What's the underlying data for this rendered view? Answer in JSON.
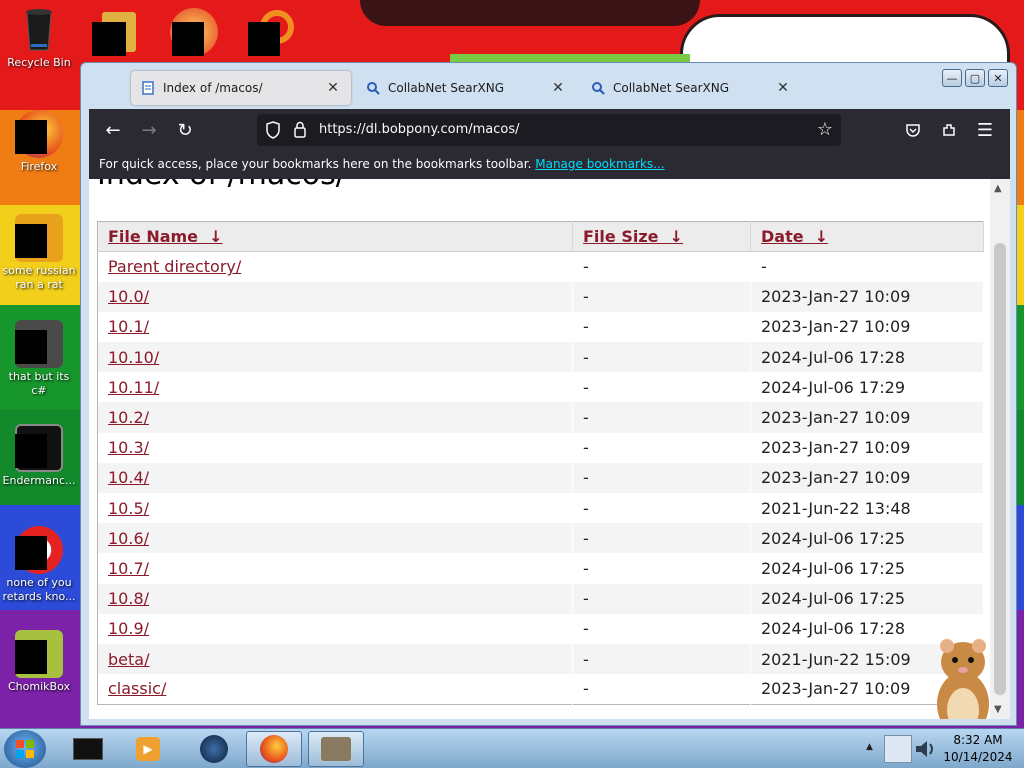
{
  "desktop": {
    "icons": [
      {
        "label": "Recycle Bin",
        "icon": "recycle-bin-icon"
      },
      {
        "label": "Firefox",
        "icon": "firefox-icon"
      },
      {
        "label": "some russian ran a rat",
        "icon": "app-icon"
      },
      {
        "label": "that but its c#",
        "icon": "windows-icon"
      },
      {
        "label": "Endermanc...",
        "icon": "terminal-icon"
      },
      {
        "label": "none of you retards kno...",
        "icon": "opera-icon"
      },
      {
        "label": "ChomikBox",
        "icon": "chomikbox-icon"
      }
    ]
  },
  "browser": {
    "tabs": [
      {
        "title": "Index of /macos/",
        "icon": "page-icon",
        "active": true
      },
      {
        "title": "CollabNet SearXNG",
        "icon": "search-icon",
        "active": false
      },
      {
        "title": "CollabNet SearXNG",
        "icon": "search-icon",
        "active": false
      }
    ],
    "window_buttons": {
      "minimize": "—",
      "maximize": "▢",
      "close": "✕"
    },
    "url": "https://dl.bobpony.com/macos/",
    "bookmarks_bar": {
      "message": "For quick access, place your bookmarks here on the bookmarks toolbar.",
      "link": "Manage bookmarks..."
    }
  },
  "page": {
    "heading": "Index of /macos/",
    "columns": [
      {
        "label": "File Name",
        "sort": "↓"
      },
      {
        "label": "File Size",
        "sort": "↓"
      },
      {
        "label": "Date",
        "sort": "↓"
      }
    ],
    "rows": [
      {
        "name": "Parent directory/",
        "size": "-",
        "date": "-"
      },
      {
        "name": "10.0/",
        "size": "-",
        "date": "2023-Jan-27 10:09"
      },
      {
        "name": "10.1/",
        "size": "-",
        "date": "2023-Jan-27 10:09"
      },
      {
        "name": "10.10/",
        "size": "-",
        "date": "2024-Jul-06 17:28"
      },
      {
        "name": "10.11/",
        "size": "-",
        "date": "2024-Jul-06 17:29"
      },
      {
        "name": "10.2/",
        "size": "-",
        "date": "2023-Jan-27 10:09"
      },
      {
        "name": "10.3/",
        "size": "-",
        "date": "2023-Jan-27 10:09"
      },
      {
        "name": "10.4/",
        "size": "-",
        "date": "2023-Jan-27 10:09"
      },
      {
        "name": "10.5/",
        "size": "-",
        "date": "2021-Jun-22 13:48"
      },
      {
        "name": "10.6/",
        "size": "-",
        "date": "2024-Jul-06 17:25"
      },
      {
        "name": "10.7/",
        "size": "-",
        "date": "2024-Jul-06 17:25"
      },
      {
        "name": "10.8/",
        "size": "-",
        "date": "2024-Jul-06 17:25"
      },
      {
        "name": "10.9/",
        "size": "-",
        "date": "2024-Jul-06 17:28"
      },
      {
        "name": "beta/",
        "size": "-",
        "date": "2021-Jun-22 15:09"
      },
      {
        "name": "classic/",
        "size": "-",
        "date": "2023-Jan-27 10:09"
      }
    ]
  },
  "taskbar": {
    "clock": {
      "time": "8:32 AM",
      "date": "10/14/2024"
    }
  },
  "colors": {
    "link": "#8b1a2b",
    "browser_chrome": "#2b2a33",
    "bookmark_link": "#00ddff"
  }
}
